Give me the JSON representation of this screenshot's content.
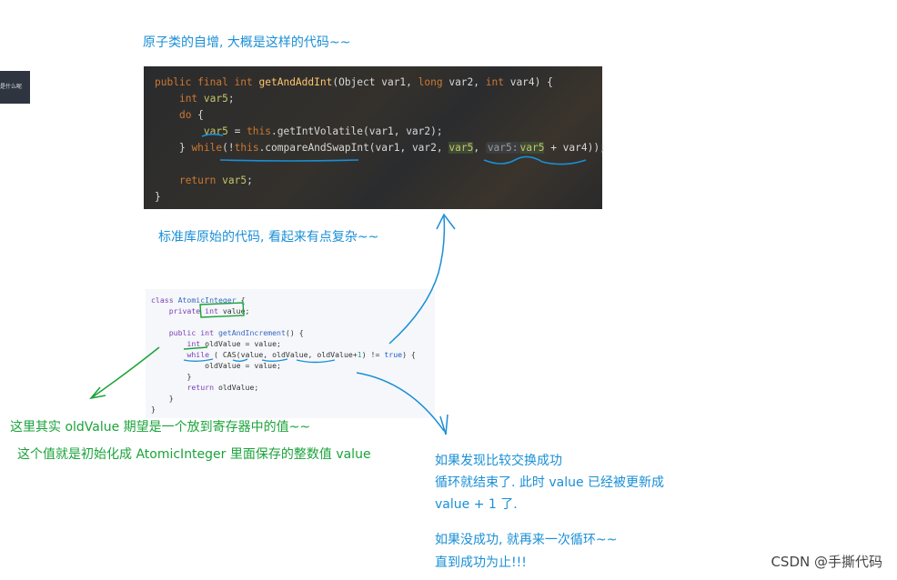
{
  "side_tab": {
    "label": "是什么呢"
  },
  "notes": {
    "atomic_intro": "原子类的自增, 大概是这样的代码~~",
    "stdlib_note": "标准库原始的代码, 看起来有点复杂~~",
    "oldvalue_note_1": "这里其实 oldValue 期望是一个放到寄存器中的值~~",
    "oldvalue_note_2": "这个值就是初始化成 AtomicInteger 里面保存的整数值 value",
    "success_1": "如果发现比较交换成功",
    "success_2": "循环就结束了. 此时 value 已经被更新成",
    "success_3": "value + 1 了.",
    "fail_1": "如果没成功, 就再来一次循环~~",
    "fail_2": "直到成功为止!!!"
  },
  "code_stdlib": {
    "line1": {
      "kw": "public final int ",
      "fn": "getAndAddInt",
      "rest": "(Object var1, ",
      "long": "long",
      "rest2": " var2, ",
      "int": "int",
      "rest3": " var4) {"
    },
    "line2": {
      "kw": "int ",
      "var": "var5",
      "rest": ";"
    },
    "line3": {
      "kw": "do",
      "rest": " {"
    },
    "line4": {
      "var": "var5",
      "rest": " = ",
      "this": "this",
      "rest2": ".getIntVolatile(var1, var2);"
    },
    "line5": {
      "pre": "} ",
      "kw": "while",
      "rest": "(!",
      "this": "this",
      "rest2": ".compareAndSwapInt(var1, var2, ",
      "var": "var5",
      "rest3": ", ",
      "hint": "var5:",
      "var2": "var5",
      "rest4": " + var4));"
    },
    "line6": {
      "kw": "return ",
      "var": "var5",
      "rest": ";"
    },
    "line7": "}"
  },
  "code_pseudo": {
    "l1": {
      "kw": "class ",
      "name": "AtomicInteger",
      "rest": " {"
    },
    "l2": {
      "kw": "private ",
      "kw2": "int",
      "rest": " value;"
    },
    "l4": {
      "kw": "public int ",
      "fn": "getAndIncrement",
      "rest": "() {"
    },
    "l5": {
      "kw": "int ",
      "var": "oldValue",
      "rest": " = value;"
    },
    "l6": {
      "kw": "while",
      "rest": " ( CAS(value, oldValue, oldValue+",
      "num": "1",
      "rest2": ") != ",
      "bool": "true",
      "rest3": ") {"
    },
    "l7": "oldValue = value;",
    "l8": "}",
    "l9": {
      "kw": "return",
      "rest": " oldValue;"
    },
    "l10": "}",
    "l11": "}"
  },
  "watermark": "CSDN @手撕代码",
  "colors": {
    "annotation_blue": "#1a8fd6",
    "annotation_green": "#1aa33a"
  }
}
